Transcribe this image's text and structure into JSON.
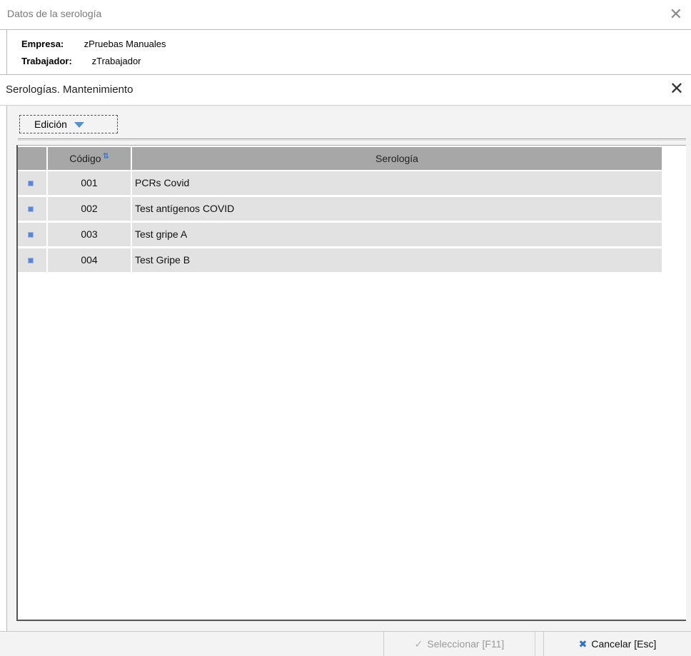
{
  "outer_window": {
    "title": "Datos de la serología",
    "close_glyph": "✕"
  },
  "info": {
    "empresa_label": "Empresa:",
    "empresa_value": "zPruebas Manuales",
    "trabajador_label": "Trabajador:",
    "trabajador_value": "zTrabajador"
  },
  "inner_window": {
    "title": "Serologías. Mantenimiento",
    "close_glyph": "✕"
  },
  "toolbar": {
    "edicion_label": "Edición"
  },
  "grid": {
    "columns": [
      {
        "label": ""
      },
      {
        "label": "Código",
        "sort_icon": "sort-az-icon",
        "sort_glyph": "⇅"
      },
      {
        "label": "Serología"
      }
    ],
    "rows": [
      {
        "codigo": "001",
        "serologia": "PCRs Covid"
      },
      {
        "codigo": "002",
        "serologia": "Test antígenos COVID"
      },
      {
        "codigo": "003",
        "serologia": "Test gripe A"
      },
      {
        "codigo": "004",
        "serologia": "Test Gripe B"
      }
    ]
  },
  "footer": {
    "seleccionar_label": "Seleccionar [F11]",
    "seleccionar_enabled": false,
    "cancelar_label": "Cancelar [Esc]"
  },
  "colors": {
    "accent": "#4f90d6",
    "header_bg": "#a7a7a7",
    "row_bg": "#e2e2e2",
    "row_indicator": "#5b85d6"
  }
}
